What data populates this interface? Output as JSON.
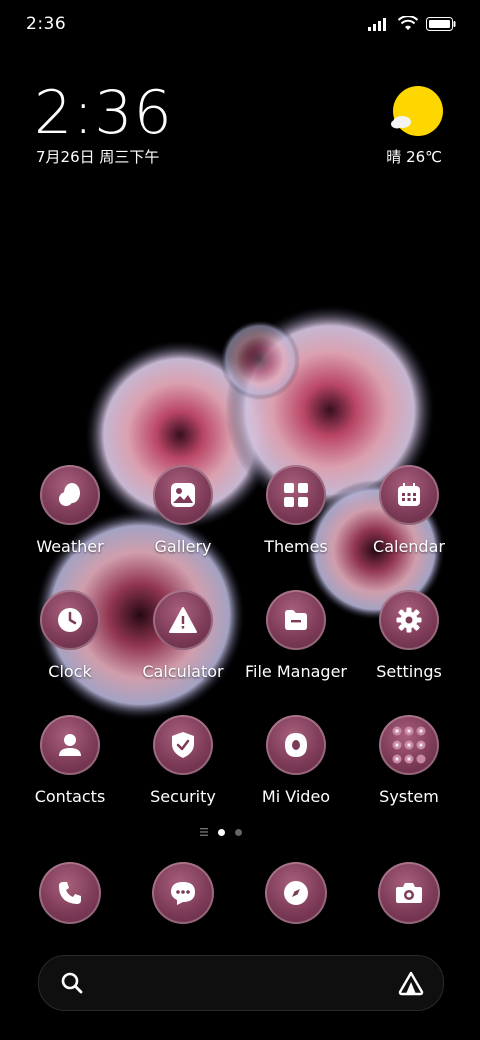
{
  "status_bar": {
    "time": "2:36"
  },
  "lockscreen": {
    "time": "2:36",
    "date": "7月26日 周三下午",
    "weather": "晴 26℃"
  },
  "apps": [
    {
      "label": "Weather",
      "icon": "weather-icon"
    },
    {
      "label": "Gallery",
      "icon": "gallery-icon"
    },
    {
      "label": "Themes",
      "icon": "themes-icon"
    },
    {
      "label": "Calendar",
      "icon": "calendar-icon"
    },
    {
      "label": "Clock",
      "icon": "clock-icon"
    },
    {
      "label": "Calculator",
      "icon": "calculator-icon"
    },
    {
      "label": "File Manager",
      "icon": "file-manager-icon"
    },
    {
      "label": "Settings",
      "icon": "settings-icon"
    },
    {
      "label": "Contacts",
      "icon": "contacts-icon"
    },
    {
      "label": "Security",
      "icon": "security-icon"
    },
    {
      "label": "Mi Video",
      "icon": "mi-video-icon"
    },
    {
      "label": "System",
      "icon": "folder-icon"
    }
  ],
  "dock": [
    {
      "icon": "phone-icon"
    },
    {
      "icon": "messages-icon"
    },
    {
      "icon": "browser-icon"
    },
    {
      "icon": "camera-icon"
    }
  ],
  "colors": {
    "icon_bg": "#7d3b58",
    "accent": "#ffd700"
  }
}
